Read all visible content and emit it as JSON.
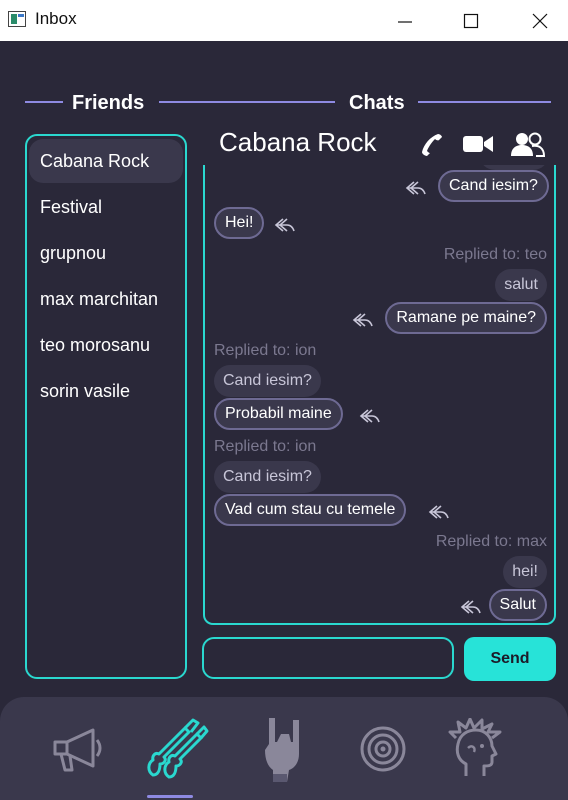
{
  "window": {
    "title": "Inbox"
  },
  "friends": {
    "heading": "Friends",
    "items": [
      {
        "label": "Cabana Rock",
        "selected": true
      },
      {
        "label": "Festival",
        "selected": false
      },
      {
        "label": "grupnou",
        "selected": false
      },
      {
        "label": "max marchitan",
        "selected": false
      },
      {
        "label": "teo morosanu",
        "selected": false
      },
      {
        "label": "sorin vasile",
        "selected": false
      }
    ]
  },
  "chats": {
    "heading": "Chats",
    "title": "Cabana Rock",
    "header_icons": [
      "phone-icon",
      "video-camera-icon",
      "group-members-icon"
    ],
    "messages": {
      "m1": "Cand iesim?",
      "m2": "Hei!",
      "reply1_label": "Replied to: teo",
      "m3_quote": "salut",
      "m3": "Ramane pe maine?",
      "reply2_label": "Replied to: ion",
      "m4_quote": "Cand iesim?",
      "m4": "Probabil maine",
      "reply3_label": "Replied to: ion",
      "m5_quote": "Cand iesim?",
      "m5": "Vad cum stau cu temele",
      "reply4_label": "Replied to: max",
      "m6_quote": "hei!",
      "m6": "Salut"
    }
  },
  "composer": {
    "value": "",
    "send_label": "Send"
  },
  "bottom_nav": {
    "items": [
      "megaphone-icon",
      "guitars-icon",
      "rock-hand-icon",
      "target-icon",
      "punk-head-icon"
    ],
    "active": "guitars-icon"
  },
  "colors": {
    "background": "#2a2839",
    "accent_teal": "#2ad8cf",
    "send_button": "#27e3d8",
    "heading_rule": "#8e8ae2",
    "bubble": "#3a384c"
  }
}
